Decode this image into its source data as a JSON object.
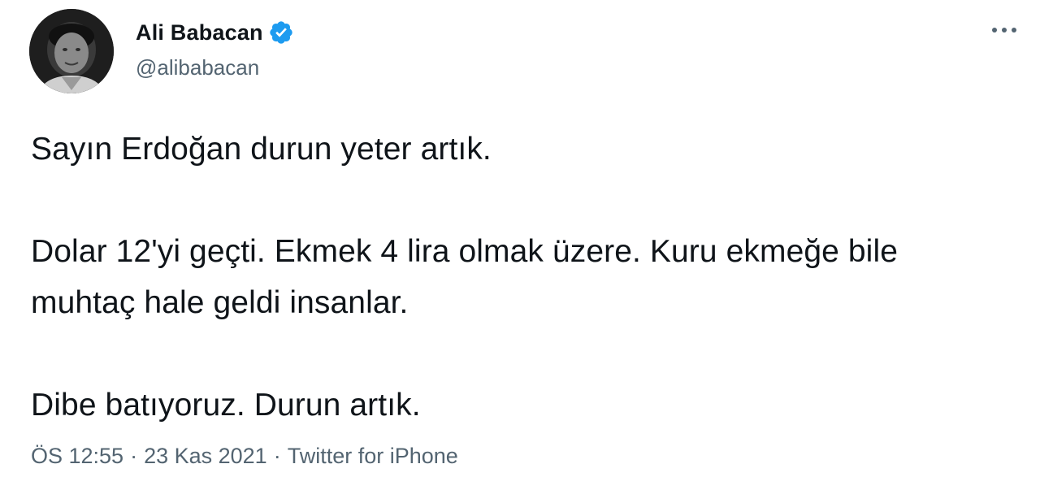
{
  "author": {
    "display_name": "Ali Babacan",
    "handle": "@alibabacan",
    "verified": true,
    "verified_color": "#1d9bf0"
  },
  "icons": {
    "more": "more-horizontal-icon",
    "verified": "verified-badge-icon"
  },
  "tweet": {
    "paragraphs": [
      "Sayın Erdoğan durun yeter artık.",
      "Dolar 12'yi geçti. Ekmek 4 lira olmak üzere. Kuru ekmeğe bile muhtaç hale geldi insanlar.",
      "Dibe batıyoruz. Durun artık."
    ]
  },
  "meta": {
    "time": "ÖS 12:55",
    "separator": "·",
    "date": "23 Kas 2021",
    "source": "Twitter for iPhone"
  },
  "colors": {
    "text": "#0f1419",
    "secondary": "#536471",
    "accent": "#1d9bf0"
  }
}
